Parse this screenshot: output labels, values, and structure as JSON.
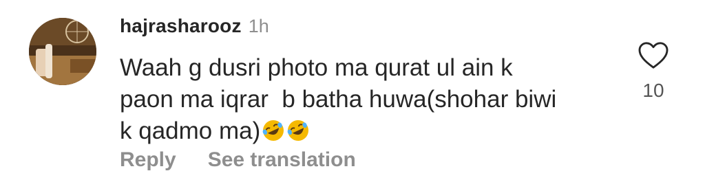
{
  "comment": {
    "username": "hajrasharooz",
    "time": "1h",
    "lines": [
      "Waah g dusri photo ma qurat ul ain k",
      "paon ma iqrar  b batha huwa(shohar biwi",
      "k qadmo ma)"
    ],
    "emojis": [
      "rolling-on-floor-laughing",
      "rolling-on-floor-laughing"
    ],
    "like_count": "10",
    "reply_label": "Reply",
    "translation_label": "See translation"
  },
  "colors": {
    "text": "#262626",
    "muted": "#8e8e8e",
    "emoji": "#f5b900"
  }
}
